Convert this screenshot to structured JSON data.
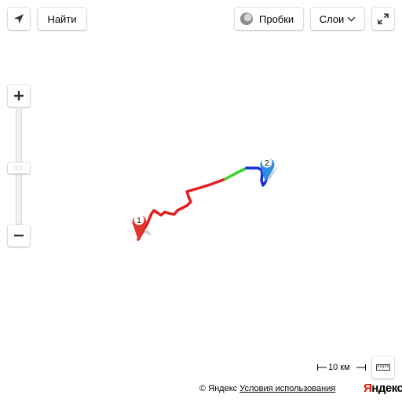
{
  "toolbar": {
    "geolocation_icon": "arrow-navigation-icon",
    "find_label": "Найти",
    "traffic_label": "Пробки",
    "traffic_icon": "traffic-circle-icon",
    "layers_label": "Слои",
    "layers_icon": "chevron-down-icon",
    "fullscreen_icon": "expand-icon"
  },
  "zoom": {
    "in_icon": "plus-icon",
    "out_icon": "minus-icon",
    "slider_icon": "grip-icon"
  },
  "route": {
    "start_label": "1",
    "end_label": "2",
    "colors": {
      "slow": "#e31e1e",
      "medium": "#37d22c",
      "fast": "#1a2be0",
      "start_marker": "#e3362b",
      "end_marker": "#2f8fdf"
    }
  },
  "scale": {
    "label": "10 км"
  },
  "ruler_icon": "ruler-icon",
  "footer": {
    "copyright": "© Яндекс",
    "terms_link": "Условия использования",
    "logo_part1": "Я",
    "logo_part2": "ндекс"
  }
}
